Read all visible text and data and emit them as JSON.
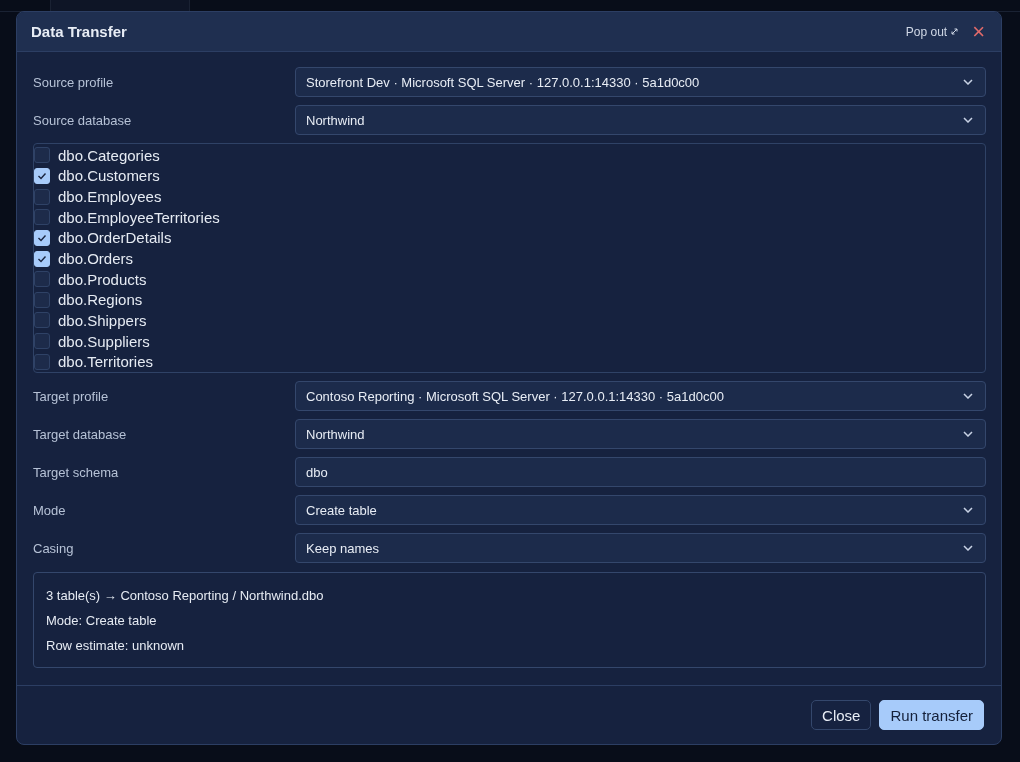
{
  "dialog": {
    "title": "Data Transfer",
    "pop_out": "Pop out",
    "close": "×"
  },
  "source_fields": [
    {
      "kind": "select",
      "label": "Source profile",
      "value": "Storefront Dev · Microsoft SQL Server · 127.0.0.1:14330 · 5a1d0c00"
    },
    {
      "kind": "select",
      "label": "Source database",
      "value": "Northwind"
    }
  ],
  "tables": [
    {
      "name": "dbo.Categories",
      "checked": false
    },
    {
      "name": "dbo.Customers",
      "checked": true
    },
    {
      "name": "dbo.Employees",
      "checked": false
    },
    {
      "name": "dbo.EmployeeTerritories",
      "checked": false
    },
    {
      "name": "dbo.OrderDetails",
      "checked": true
    },
    {
      "name": "dbo.Orders",
      "checked": true
    },
    {
      "name": "dbo.Products",
      "checked": false
    },
    {
      "name": "dbo.Regions",
      "checked": false
    },
    {
      "name": "dbo.Shippers",
      "checked": false
    },
    {
      "name": "dbo.Suppliers",
      "checked": false
    },
    {
      "name": "dbo.Territories",
      "checked": false
    }
  ],
  "target_fields": [
    {
      "kind": "select",
      "label": "Target profile",
      "value": "Contoso Reporting · Microsoft SQL Server · 127.0.0.1:14330 · 5a1d0c00"
    },
    {
      "kind": "select",
      "label": "Target database",
      "value": "Northwind"
    },
    {
      "kind": "input",
      "label": "Target schema",
      "value": "dbo"
    },
    {
      "kind": "select",
      "label": "Mode",
      "value": "Create table"
    },
    {
      "kind": "select",
      "label": "Casing",
      "value": "Keep names"
    }
  ],
  "summary": [
    "3 table(s) → Contoso Reporting / Northwind.dbo",
    "Mode: Create table",
    "Row estimate: unknown"
  ],
  "buttons": [
    {
      "label": "Close",
      "kind": "secondary"
    },
    {
      "label": "Run transfer",
      "kind": "primary"
    }
  ]
}
